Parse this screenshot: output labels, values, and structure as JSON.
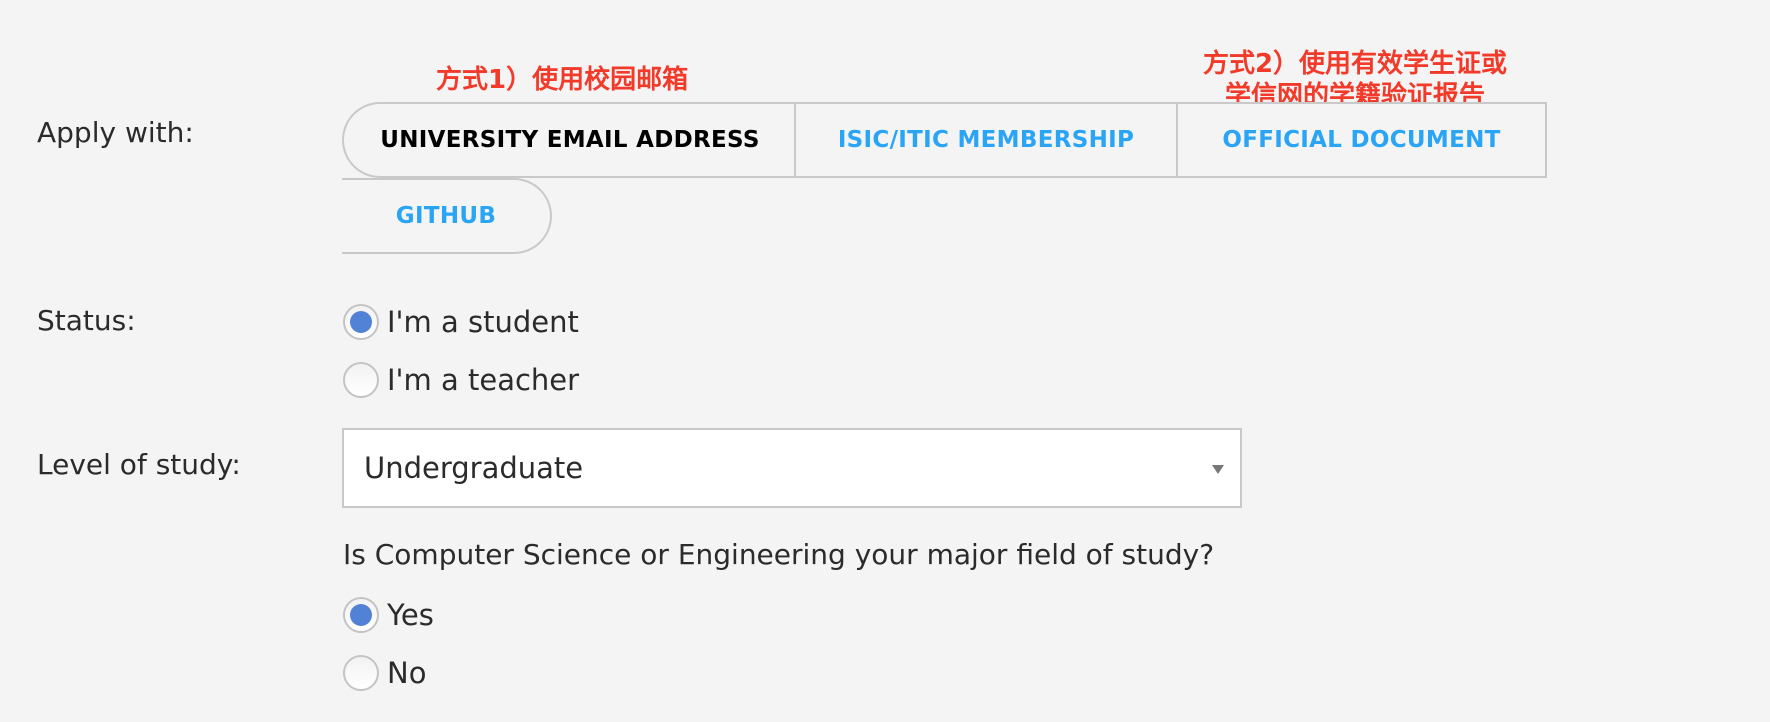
{
  "form": {
    "apply_with": {
      "label": "Apply with:",
      "tabs": [
        {
          "label": "UNIVERSITY EMAIL ADDRESS",
          "active": true
        },
        {
          "label": "ISIC/ITIC MEMBERSHIP",
          "active": false
        },
        {
          "label": "OFFICIAL DOCUMENT",
          "active": false
        },
        {
          "label": "GITHUB",
          "active": false
        }
      ]
    },
    "status": {
      "label": "Status:",
      "options": [
        {
          "label": "I'm a student",
          "checked": true
        },
        {
          "label": "I'm a teacher",
          "checked": false
        }
      ]
    },
    "level_of_study": {
      "label": "Level of study:",
      "selected": "Undergraduate"
    },
    "major_question": {
      "label": "Is Computer Science or Engineering your major field of study?",
      "options": [
        {
          "label": "Yes",
          "checked": true
        },
        {
          "label": "No",
          "checked": false
        }
      ]
    }
  },
  "annotations": {
    "method1": "方式1）使用校园邮箱",
    "method2_line1": "方式2）使用有效学生证或",
    "method2_line2": "学信网的学籍验证报告"
  },
  "colors": {
    "tab_link": "#2aa4f4",
    "annotation": "#f23a2a",
    "radio_checked": "#5282d6",
    "background": "#f4f4f4"
  }
}
